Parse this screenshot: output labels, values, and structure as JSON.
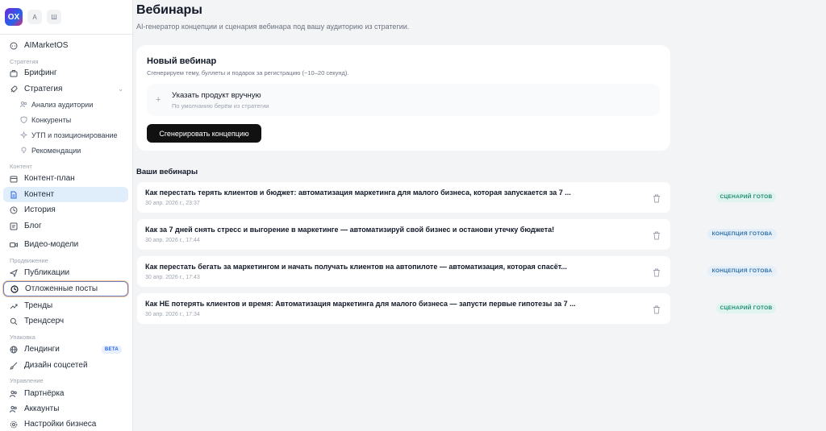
{
  "sidebar": {
    "logo": "OX",
    "workspace_buttons": [
      "А",
      "Ш"
    ],
    "items": {
      "aimarketos": "AIMarketOS",
      "section_strategy": "Стратегия",
      "briefing": "Брифинг",
      "strategy": "Стратегия",
      "audience": "Анализ аудитории",
      "competitors": "Конкуренты",
      "utp": "УТП и позиционирование",
      "recommendations": "Рекомендации",
      "section_content": "Контент",
      "content_plan": "Контент-план",
      "content": "Контент",
      "history": "История",
      "blog": "Блог",
      "video_models": "Видео-модели",
      "section_promotion": "Продвижение",
      "publications": "Публикации",
      "scheduled": "Отложенные посты",
      "trends": "Тренды",
      "trendsearch": "Трендсерч",
      "section_packaging": "Упаковка",
      "landings": "Лендинги",
      "landings_badge": "BETA",
      "social_design": "Дизайн соцсетей",
      "section_management": "Управление",
      "partner": "Партнёрка",
      "accounts": "Аккаунты",
      "business_settings": "Настройки бизнеса"
    }
  },
  "main": {
    "title": "Вебинары",
    "subtitle": "AI-генератор концепции и сценария вебинара под вашу аудиторию из стратегии.",
    "new_webinar": {
      "title": "Новый вебинар",
      "subtitle": "Сгенерируем тему, буллеты и подарок за регистрацию (~10–20 секунд).",
      "product_title": "Указать продукт вручную",
      "product_sub": "По умолчанию берём из стратегии",
      "generate_button": "Сгенерировать концепцию"
    },
    "list_title": "Ваши вебинары",
    "webinars": [
      {
        "title": "Как перестать терять клиентов и бюджет: автоматизация маркетинга для малого бизнеса, которая запускается за 7 ...",
        "date": "30 апр. 2026 г., 23:37",
        "status": "СЦЕНАРИЙ ГОТОВ"
      },
      {
        "title": "Как за 7 дней снять стресс и выгорение в маркетинге — автоматизируй свой бизнес и останови утечку бюджета!",
        "date": "30 апр. 2026 г., 17:44",
        "status": "КОНЦЕПЦИЯ ГОТОВА"
      },
      {
        "title": "Как перестать бегать за маркетингом и начать получать клиентов на автопилоте — автоматизация, которая спасёт...",
        "date": "30 апр. 2026 г., 17:43",
        "status": "КОНЦЕПЦИЯ ГОТОВА"
      },
      {
        "title": "Как НЕ потерять клиентов и время: Автоматизация маркетинга для малого бизнеса — запусти первые гипотезы за 7 ...",
        "date": "30 апр. 2026 г., 17:34",
        "status": "СЦЕНАРИЙ ГОТОВ"
      }
    ]
  },
  "colors": {
    "accent_dark": "#111111",
    "active_bg": "#e0edfa",
    "scenario_badge": "#1c8a6e",
    "concept_badge": "#2f6fa5"
  }
}
